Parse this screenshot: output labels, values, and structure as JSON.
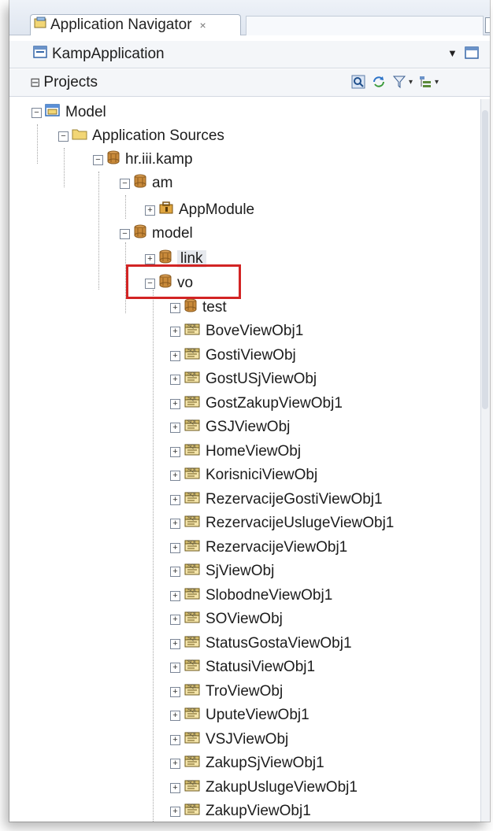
{
  "tab": {
    "title": "Application Navigator",
    "close": "×"
  },
  "app": {
    "name": "KampApplication"
  },
  "projects": {
    "title": "Projects"
  },
  "tree": {
    "model": "Model",
    "app_sources": "Application Sources",
    "pkg": "hr.iii.kamp",
    "am": "am",
    "appmodule": "AppModule",
    "model_pkg": "model",
    "link": "link",
    "vo": "vo",
    "test": "test",
    "view_objects": [
      "BoveViewObj1",
      "GostiViewObj",
      "GostUSjViewObj",
      "GostZakupViewObj1",
      "GSJViewObj",
      "HomeViewObj",
      "KorisniciViewObj",
      "RezervacijeGostiViewObj1",
      "RezervacijeUslugeViewObj1",
      "RezervacijeViewObj1",
      "SjViewObj",
      "SlobodneViewObj1",
      "SOViewObj",
      "StatusGostaViewObj1",
      "StatusiViewObj1",
      "TroViewObj",
      "UputeViewObj1",
      "VSJViewObj",
      "ZakupSjViewObj1",
      "ZakupUslugeViewObj1",
      "ZakupViewObj1"
    ]
  },
  "colors": {
    "highlight": "#d22424",
    "folder": "#f2d675",
    "package": "#c98a3a"
  }
}
